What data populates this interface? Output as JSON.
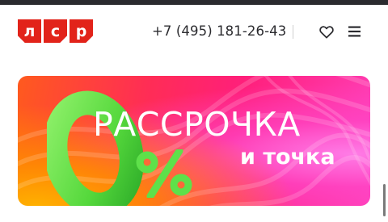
{
  "header": {
    "logo_letters": [
      "л",
      "с",
      "р"
    ],
    "logo_color": "#e2231a",
    "phone": "+7 (495) 181-26-43",
    "favorites_icon": "heart-icon",
    "menu_icon": "hamburger-menu-icon"
  },
  "banner": {
    "big_number": "0",
    "percent_sign": "%",
    "headline": "РАССРОЧКА",
    "subline": "и точка",
    "accent_green": "#5ee04a"
  }
}
